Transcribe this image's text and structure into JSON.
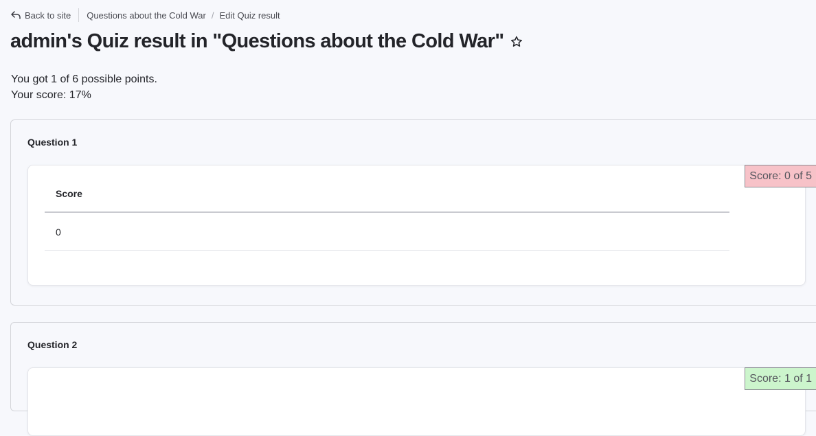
{
  "breadcrumb": {
    "back_label": "Back to site",
    "quiz_link": "Questions about the Cold War",
    "current": "Edit Quiz result"
  },
  "page": {
    "title": "admin's Quiz result in \"Questions about the Cold War\""
  },
  "summary": {
    "points_text": "You got 1 of 6 possible points.",
    "score_text": "Your score: 17%"
  },
  "questions": [
    {
      "title": "Question 1",
      "score_badge": "Score: 0 of 5",
      "status": "incorrect",
      "table": {
        "header": "Score",
        "rows": [
          "0"
        ]
      }
    },
    {
      "title": "Question 2",
      "score_badge": "Score: 1 of 1",
      "status": "correct"
    }
  ],
  "colors": {
    "fail_badge": "#f7c2c8",
    "pass_badge": "#ccf5cc",
    "page_bg": "#f7f8fc"
  },
  "icons": {
    "back": "back-arrow-icon",
    "favorite": "star-outline-icon"
  }
}
